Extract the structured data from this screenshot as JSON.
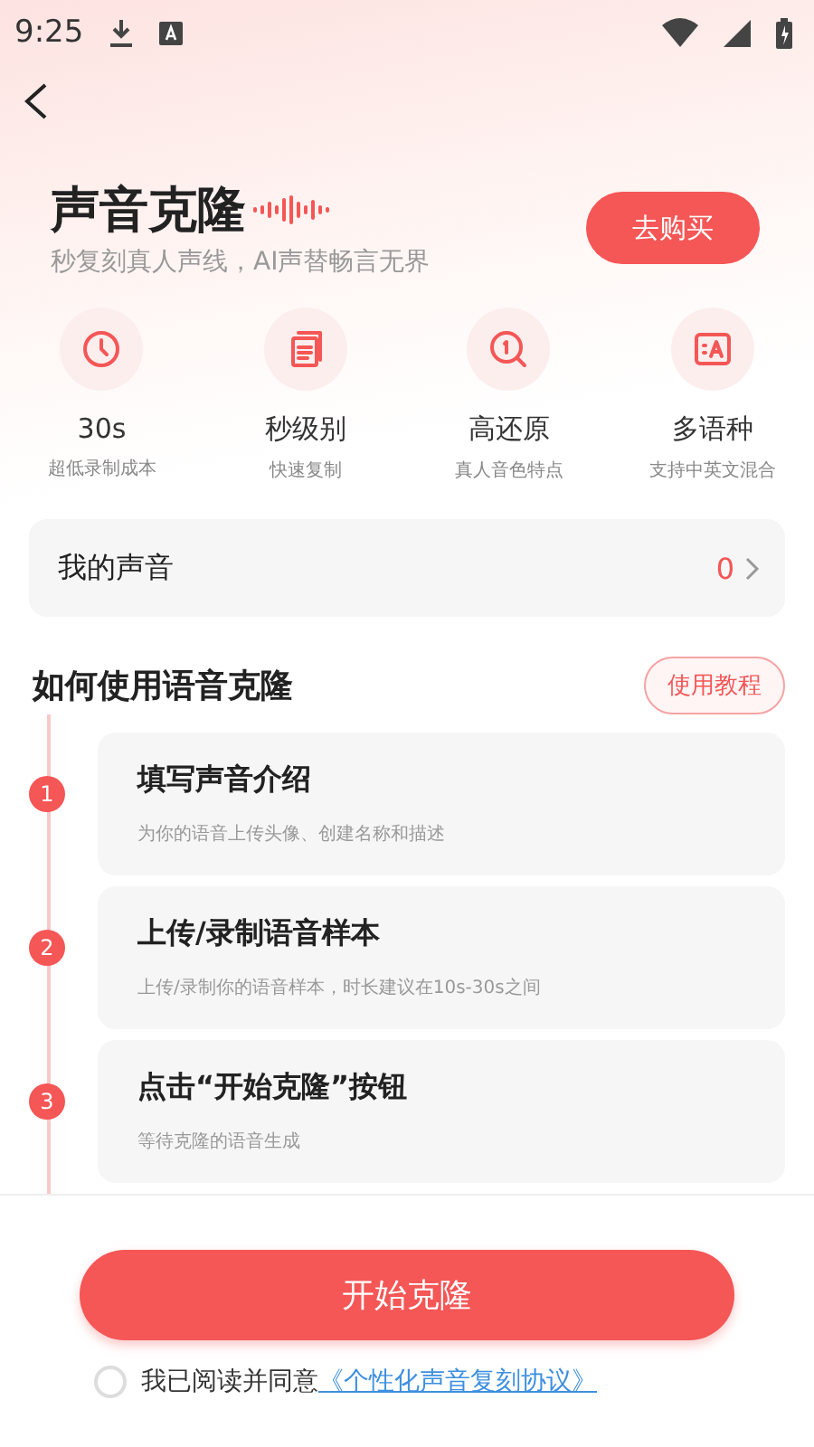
{
  "status_bar": {
    "time": "9:25"
  },
  "header": {
    "title": "声音克隆",
    "subtitle": "秒复刻真人声线，AI声替畅言无界",
    "buy_button": "去购买"
  },
  "features": [
    {
      "kind": "clock",
      "title": "30s",
      "caption": "超低录制成本"
    },
    {
      "kind": "pages",
      "title": "秒级别",
      "caption": "快速复制"
    },
    {
      "kind": "search",
      "title": "高还原",
      "caption": "真人音色特点"
    },
    {
      "kind": "translate",
      "title": "多语种",
      "caption": "支持中英文混合"
    }
  ],
  "my_voice": {
    "label": "我的声音",
    "count": "0"
  },
  "how_to": {
    "title": "如何使用语音克隆",
    "tutorial_button": "使用教程"
  },
  "steps": [
    {
      "number": "1",
      "title": "填写声音介绍",
      "description": "为你的语音上传头像、创建名称和描述"
    },
    {
      "number": "2",
      "title": "上传/录制语音样本",
      "description": "上传/录制你的语音样本，时长建议在10s-30s之间"
    },
    {
      "number": "3",
      "title": "点击“开始克隆”按钮",
      "description": "等待克隆的语音生成"
    }
  ],
  "footer": {
    "start_button": "开始克隆",
    "agreement": {
      "checked": false,
      "text": "我已阅读并同意",
      "link": "《个性化声音复刻协议》"
    }
  }
}
